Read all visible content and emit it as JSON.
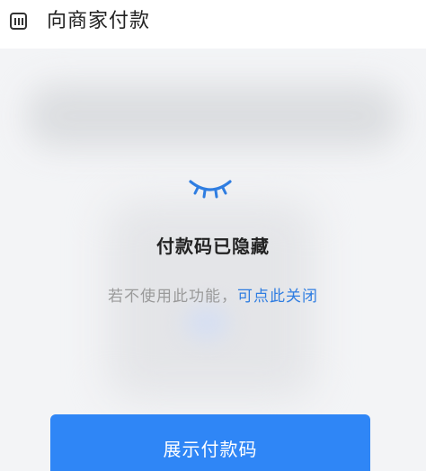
{
  "header": {
    "title": "向商家付款",
    "icon": "barcode-icon"
  },
  "status": {
    "icon": "closed-eye-icon",
    "accent_color": "#2f7de1",
    "title": "付款码已隐藏",
    "hint_prefix": "若不使用此功能，",
    "hint_link": "可点此关闭"
  },
  "actions": {
    "show_label": "展示付款码",
    "button_color": "#2f86f6"
  }
}
